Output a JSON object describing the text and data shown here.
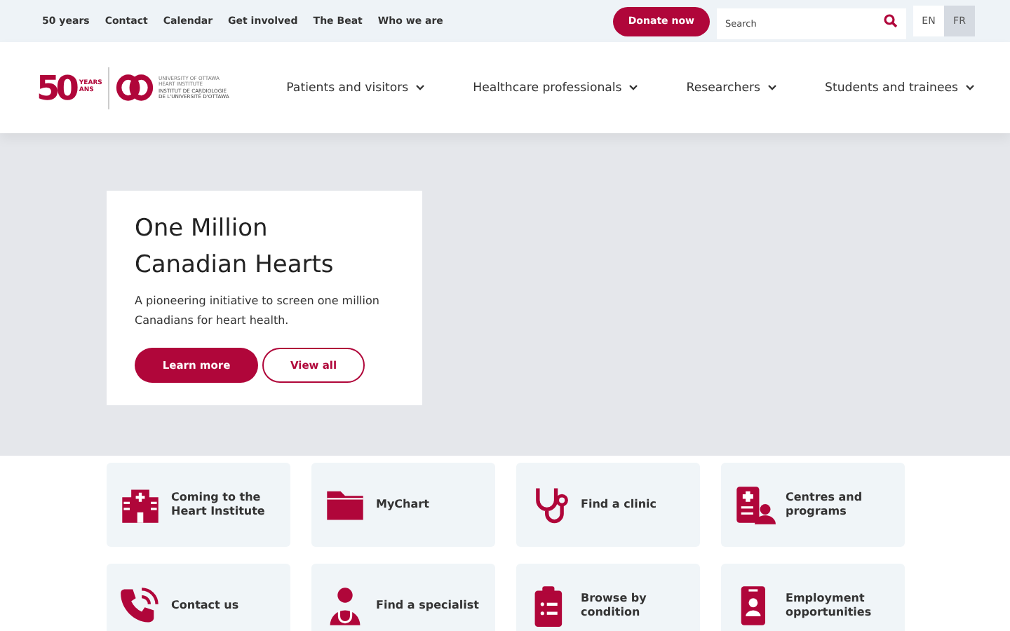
{
  "utility_nav": {
    "links": [
      "50 years",
      "Contact",
      "Calendar",
      "Get involved",
      "The Beat",
      "Who we are"
    ],
    "donate": "Donate now",
    "search": {
      "placeholder": "Search"
    },
    "languages": [
      {
        "label": "EN",
        "selected": false
      },
      {
        "label": "FR",
        "selected": true
      }
    ]
  },
  "logo": {
    "number": "50",
    "years": "YEARS",
    "ans": "ANS",
    "line_1": "UNIVERSITY OF OTTAWA",
    "line_2": "HEART INSTITUTE",
    "line_3": "INSTITUT DE CARDIOLOGIE",
    "line_4": "DE L'UNIVERSITÉ D'OTTAWA"
  },
  "main_nav": [
    "Patients and visitors",
    "Healthcare professionals",
    "Researchers",
    "Students and trainees"
  ],
  "hero": {
    "title": "One Million Canadian Hearts",
    "text": "A pioneering initiative to screen one million Canadians for heart health.",
    "buttons": [
      {
        "label": "Learn more",
        "kind": "primary"
      },
      {
        "label": "View all",
        "kind": "outline"
      }
    ]
  },
  "tiles": [
    {
      "label": "Coming to the Heart Institute",
      "kind": "hospital"
    },
    {
      "label": "MyChart",
      "kind": "folder"
    },
    {
      "label": "Find a clinic",
      "kind": "stethoscope"
    },
    {
      "label": "Centres and programs",
      "kind": "clinic"
    },
    {
      "label": "Contact us",
      "kind": "phone"
    },
    {
      "label": "Find a specialist",
      "kind": "doctor"
    },
    {
      "label": "Browse by condition",
      "kind": "clipboard"
    },
    {
      "label": "Employment opportunities",
      "kind": "badge"
    }
  ]
}
